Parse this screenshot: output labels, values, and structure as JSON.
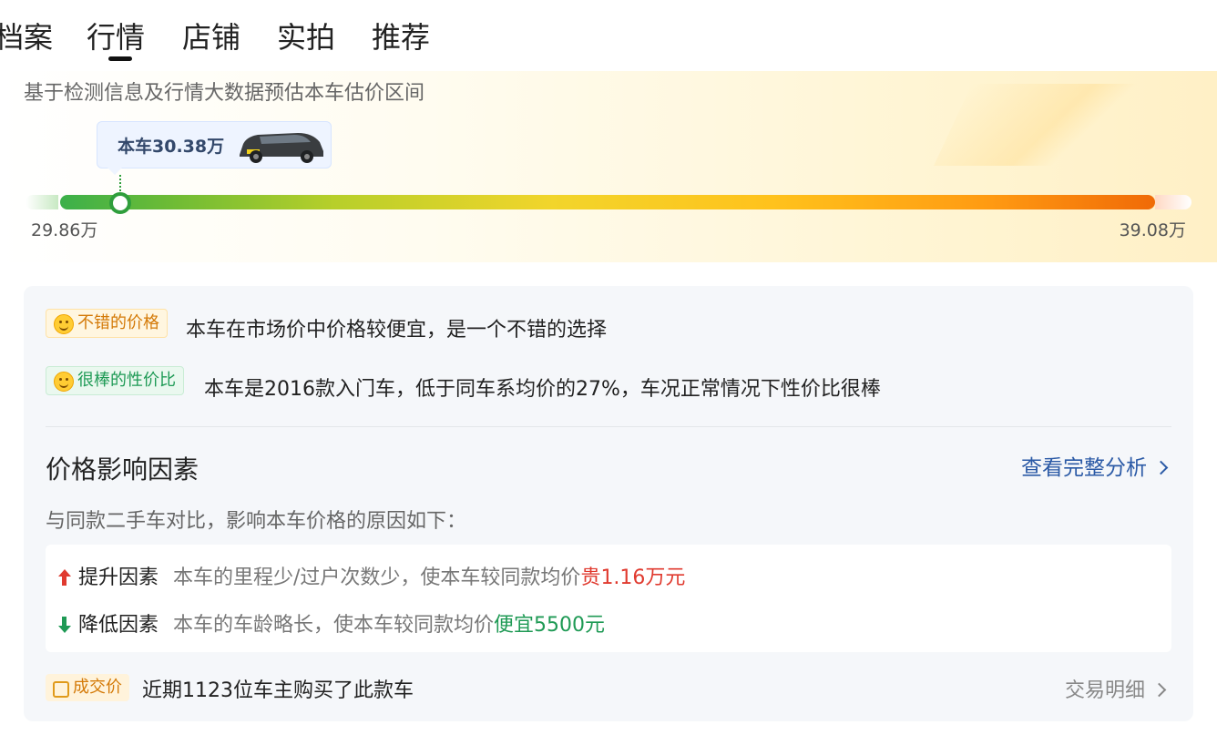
{
  "tabs": [
    {
      "label": "档案"
    },
    {
      "label": "行情",
      "active": true
    },
    {
      "label": "店铺"
    },
    {
      "label": "实拍"
    },
    {
      "label": "推荐"
    }
  ],
  "hero": {
    "subtitle": "基于检测信息及行情大数据预估本车估价区间",
    "car_price_label": "本车30.38万",
    "range_min": "29.86万",
    "range_max": "39.08万",
    "car_position_fraction": 0.055
  },
  "verdicts": [
    {
      "tag": "不错的价格",
      "text": "本车在市场价中价格较便宜，是一个不错的选择",
      "color": "#d47a08"
    },
    {
      "tag": "很棒的性价比",
      "text": "本车是2016款入门车，低于同车系均价的27%，车况正常情况下性价比很棒",
      "color": "#1e9a55"
    }
  ],
  "factors": {
    "title": "价格影响因素",
    "link": "查看完整分析",
    "compare_text": "与同款二手车对比，影响本车价格的原因如下：",
    "up": {
      "label": "提升因素",
      "desc_prefix": "本车的里程少/过户次数少，使本车较同款均价",
      "highlight": "贵1.16万元"
    },
    "down": {
      "label": "降低因素",
      "desc_prefix": "本车的车龄略长，使本车较同款均价",
      "highlight": "便宜5500元"
    }
  },
  "deal": {
    "tag": "成交价",
    "text": "近期1123位车主购买了此款车",
    "link": "交易明细"
  },
  "colors": {
    "accent_blue": "#2b5aa6",
    "up_red": "#e03a2f",
    "down_green": "#1f9a55"
  }
}
